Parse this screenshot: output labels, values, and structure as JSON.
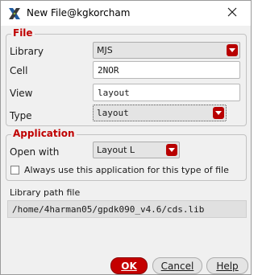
{
  "window": {
    "title": "New File@kgkorcham",
    "app_icon": "x-logo-icon",
    "close_icon": "close-icon"
  },
  "file_group": {
    "title": "File",
    "library": {
      "label": "Library",
      "value": "MJS"
    },
    "cell": {
      "label": "Cell",
      "value": "2NOR"
    },
    "view": {
      "label": "View",
      "value": "layout"
    },
    "type": {
      "label": "Type",
      "value": "layout"
    }
  },
  "application_group": {
    "title": "Application",
    "open_with": {
      "label": "Open with",
      "value": "Layout L"
    },
    "always_use": {
      "label": "Always use this application for this type of file",
      "checked": false
    }
  },
  "library_path": {
    "label": "Library path file",
    "value": "/home/4harman05/gpdk090_v4.6/cds.lib"
  },
  "buttons": {
    "ok": "OK",
    "cancel": "Cancel",
    "help": "Help"
  },
  "colors": {
    "accent": "#c40000",
    "group_title": "#c00000",
    "dropdown_arrow": "#b80000"
  }
}
